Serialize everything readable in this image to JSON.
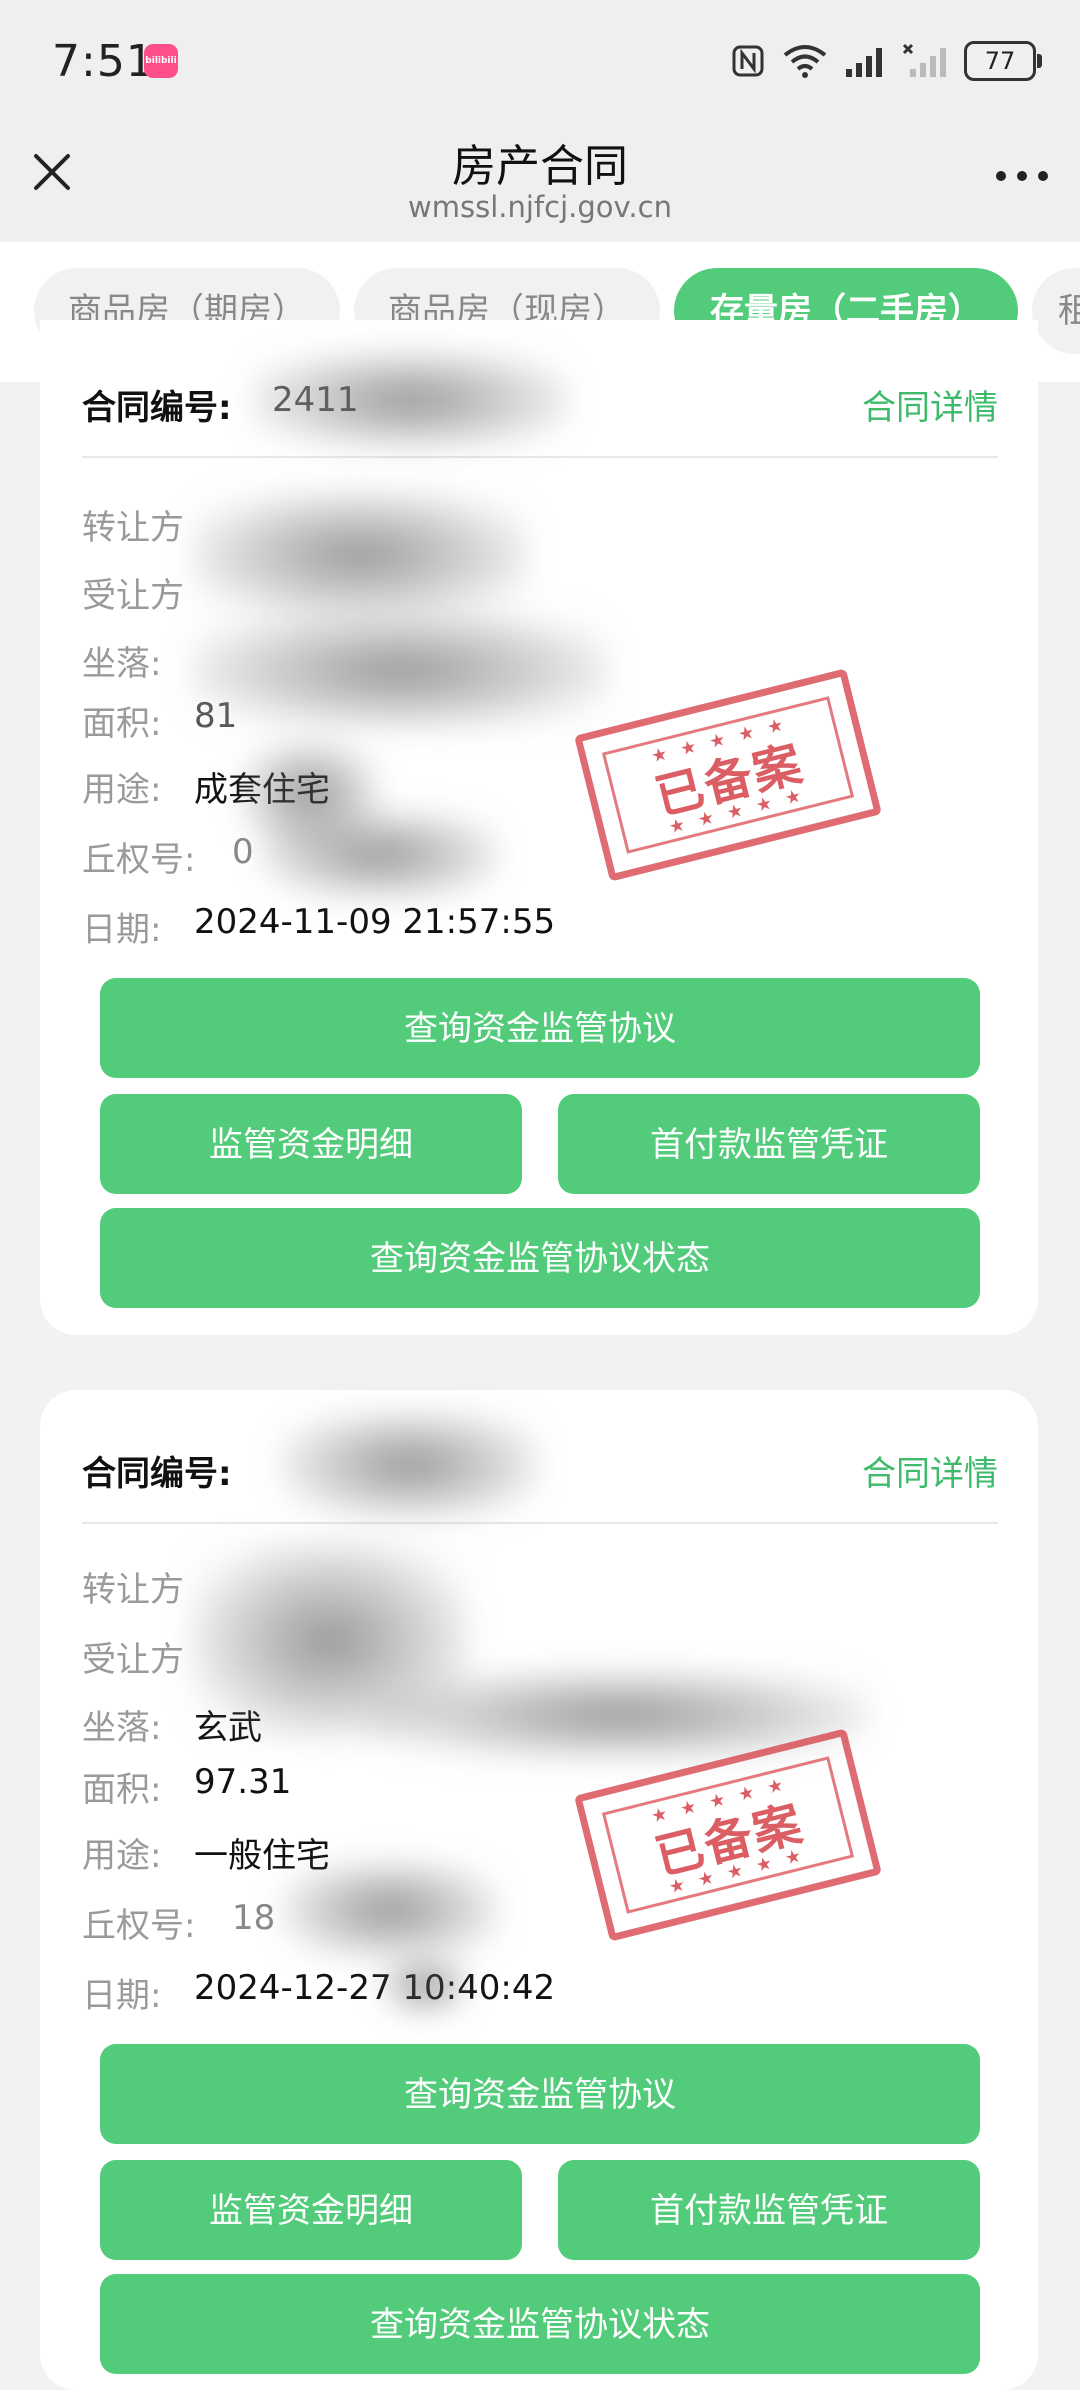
{
  "status_bar": {
    "time": "7:51",
    "app_badge": "bilibili",
    "battery": "77"
  },
  "header": {
    "title": "房产合同",
    "url": "wmssl.njfcj.gov.cn"
  },
  "tabs": [
    {
      "label": "商品房（期房）"
    },
    {
      "label": "商品房（现房）"
    },
    {
      "label": "存量房（二手房）"
    },
    {
      "label": "租"
    }
  ],
  "labels": {
    "contract_no": "合同编号:",
    "detail": "合同详情",
    "transferor": "转让方",
    "transferee": "受让方",
    "location": "坐落:",
    "area": "面积:",
    "usage": "用途:",
    "cert_no": "丘权号:",
    "date": "日期:",
    "stamp": "已备案"
  },
  "buttons": {
    "query_agreement": "查询资金监管协议",
    "fund_detail": "监管资金明细",
    "down_payment": "首付款监管凭证",
    "query_status": "查询资金监管协议状态"
  },
  "contracts": [
    {
      "contract_no_partial": "2411",
      "area_partial": "81",
      "usage": "成套住宅",
      "cert_no_partial": "0",
      "date": "2024-11-09 21:57:55"
    },
    {
      "location_partial": "玄武",
      "area": "97.31",
      "usage": "一般住宅",
      "cert_no_partial": "18",
      "date": "2024-12-27 10:40:42"
    }
  ]
}
